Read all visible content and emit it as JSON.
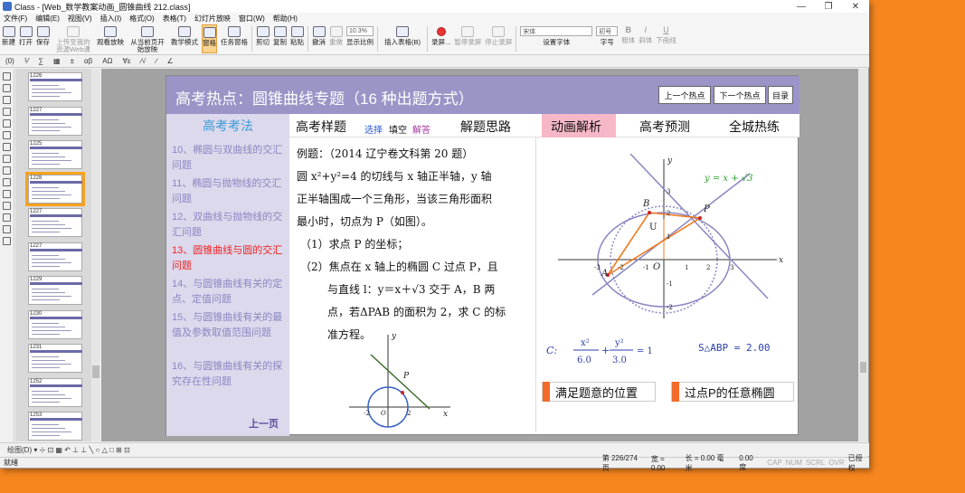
{
  "window": {
    "title": "Class - [Web_数学教案动画_圆锥曲线 212.class]",
    "minimize": "—",
    "restore": "❐",
    "close": "✕"
  },
  "menu": [
    "文件(F)",
    "编辑(E)",
    "视图(V)",
    "插入(I)",
    "格式(O)",
    "表格(T)",
    "幻灯片放映",
    "窗口(W)",
    "帮助(H)"
  ],
  "toolbar": {
    "new": "新建",
    "open": "打开",
    "save": "保存",
    "upload": "上传至我的资源Web课",
    "watch": "观看放映",
    "from_current": "从当前页开始放映",
    "teacher_mode": "教学模式",
    "window": "窗格",
    "task_window": "任务窗格",
    "cut": "剪切",
    "copy": "复制",
    "paste": "粘贴",
    "undo": "撤消",
    "redo": "重做",
    "zoom_value": "10.3%",
    "zoom_label": "显示比例",
    "insert_table": "插入表格(B)",
    "record": "录屏...",
    "pause_record": "暂停录屏",
    "stop_record": "停止录屏",
    "font_value": "宋体",
    "font_label": "设置字体",
    "size_value": "初号",
    "size_label": "字号",
    "bold": "粗体",
    "italic": "斜体",
    "underline": "下画线"
  },
  "toolbar2": [
    "(0)",
    "⅟",
    "∑",
    "▦",
    "±",
    "αβ",
    "ΑΩ",
    "∀ε",
    "⁄√",
    "∕",
    "∠"
  ],
  "thumbnails": [
    {
      "label": "1226",
      "selected": false
    },
    {
      "label": "1227",
      "selected": false
    },
    {
      "label": "1225",
      "selected": false
    },
    {
      "label": "1228",
      "selected": true
    },
    {
      "label": "1227",
      "selected": false
    },
    {
      "label": "1227",
      "selected": false
    },
    {
      "label": "1229",
      "selected": false
    },
    {
      "label": "1230",
      "selected": false
    },
    {
      "label": "1231",
      "selected": false
    },
    {
      "label": "1252",
      "selected": false
    },
    {
      "label": "1253",
      "selected": false
    }
  ],
  "slide": {
    "title": "高考热点：圆锥曲线专题（16 种出题方式）",
    "nav": {
      "prev_hot": "上一个热点",
      "next_hot": "下一个热点",
      "toc": "目录"
    },
    "side_header": "高考考法",
    "tabs": {
      "sample": "高考样题",
      "choice": "选择",
      "fill": "填空",
      "answer": "解答",
      "idea": "解题思路",
      "animation": "动画解析",
      "predict": "高考预测",
      "hot": "全城热练"
    },
    "toc": [
      {
        "text": "10、椭圆与双曲线的交汇问题",
        "current": false
      },
      {
        "text": "11、椭圆与抛物线的交汇问题",
        "current": false
      },
      {
        "text": "12、双曲线与抛物线的交汇问题",
        "current": false
      },
      {
        "text": "13、圆锥曲线与圆的交汇问题",
        "current": true
      },
      {
        "text": "14、与圆锥曲线有关的定点、定值问题",
        "current": false
      },
      {
        "text": "15、与圆锥曲线有关的最值及参数取值范围问题",
        "current": false
      },
      {
        "text": "16、与圆锥曲线有关的探究存在性问题",
        "current": false
      }
    ],
    "prev_page": "上一页",
    "problem": {
      "heading": "例题：（2014 辽宁卷文科第 20 题）",
      "line1": "圆 x²+y²=4 的切线与 x 轴正半轴，y 轴",
      "line2": "正半轴围成一个三角形，当该三角形面积",
      "line3": "最小时，切点为 P（如图）。",
      "q1": "（1）求点 P 的坐标；",
      "q2a": "（2）焦点在 x 轴上的椭圆 C 过点 P，且",
      "q2b": "与直线 l：y＝x＋√3 交于 A，B 两",
      "q2c": "点，若ΔPAB 的面积为 2，求 C 的标",
      "q2d": "准方程。"
    },
    "graph_small": {
      "x": "x",
      "y": "y",
      "p": "P",
      "m2": "-2",
      "p2": "2",
      "o": "O"
    },
    "graph_large": {
      "line_label": "y = x + √3",
      "x": "x",
      "y": "y",
      "B": "B",
      "U": "U",
      "P": "P",
      "A": "A",
      "O": "O",
      "xticks": [
        "-3",
        "-2",
        "-1",
        "1",
        "2",
        "3"
      ],
      "yticks": [
        "3",
        "2",
        "1",
        "-1",
        "-2"
      ]
    },
    "ellipse_eq": {
      "c": "C:",
      "num1": "x²",
      "den1": "6.0",
      "num2": "y²",
      "den2": "3.0",
      "rhs": "= 1"
    },
    "area": "S△ABP = 2.00",
    "buttons": {
      "satisfy": "满足题意的位置",
      "any_ellipse": "过点P的任意椭圆"
    }
  },
  "drawbar": "绘图(D) ▾  ⊹  ⊡  ▦  ↶  ⊥  ⊥  ╲  ○  △  □  ⊞  ⊡",
  "status": {
    "ready": "就绪",
    "page": "第 226/274 页",
    "width": "宽 = 0.00",
    "length": "长 = 0.00 毫米",
    "size": "0.00 度",
    "cap": "CAP",
    "num": "NUM",
    "scrl": "SCRL",
    "ovr": "OVR",
    "auth": "已授权"
  }
}
